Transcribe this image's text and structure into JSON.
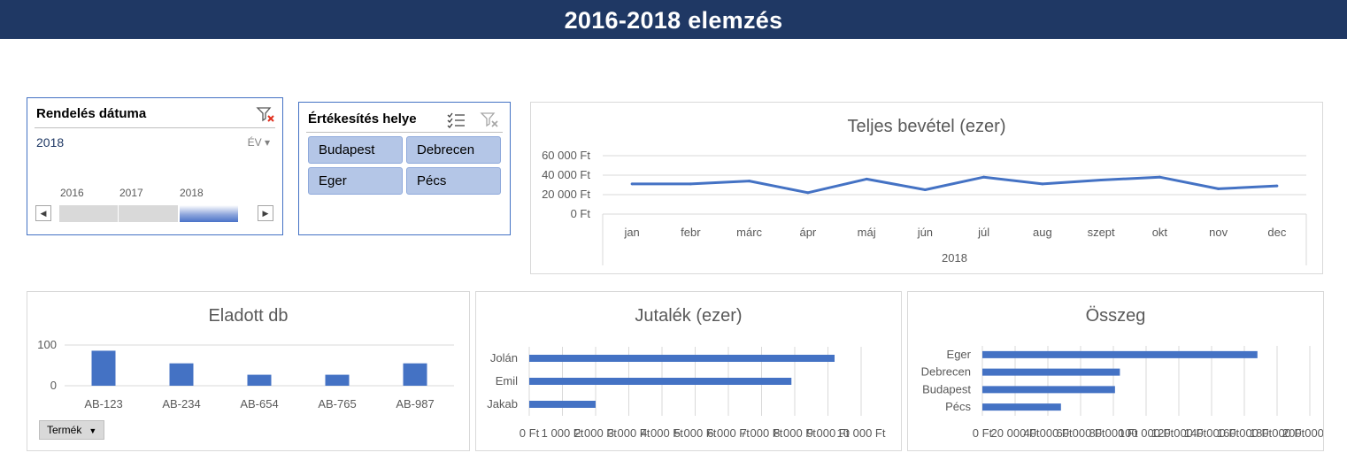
{
  "page_title": "2016-2018 elemzés",
  "timeline": {
    "title": "Rendelés dátuma",
    "selected": "2018",
    "level": "ÉV ▾",
    "years": [
      "2016",
      "2017",
      "2018"
    ],
    "selected_year": "2018"
  },
  "location_slicer": {
    "title": "Értékesítés helye",
    "items": [
      "Budapest",
      "Debrecen",
      "Eger",
      "Pécs"
    ]
  },
  "colors": {
    "accent": "#4472c4",
    "header": "#1f3864",
    "button": "#b4c6e7"
  },
  "chart_data": [
    {
      "type": "line",
      "title": "Teljes bevétel (ezer)",
      "categories": [
        "jan",
        "febr",
        "márc",
        "ápr",
        "máj",
        "jún",
        "júl",
        "aug",
        "szept",
        "okt",
        "nov",
        "dec"
      ],
      "group_label": "2018",
      "values": [
        31000,
        31000,
        34000,
        22000,
        36000,
        25000,
        38000,
        31000,
        35000,
        38000,
        26000,
        29000
      ],
      "ylim": [
        0,
        60000
      ],
      "yticks": [
        "0 Ft",
        "20 000 Ft",
        "40 000 Ft",
        "60 000 Ft"
      ],
      "grid": true
    },
    {
      "type": "bar",
      "title": "Eladott db",
      "categories": [
        "AB-123",
        "AB-234",
        "AB-654",
        "AB-765",
        "AB-987"
      ],
      "values": [
        86,
        55,
        27,
        27,
        55
      ],
      "ylim": [
        0,
        100
      ],
      "yticks": [
        "0",
        "100"
      ],
      "field_button": "Termék"
    },
    {
      "type": "bar",
      "orientation": "horizontal",
      "title": "Jutalék (ezer)",
      "categories": [
        "Jolán",
        "Emil",
        "Jakab"
      ],
      "values": [
        9200,
        7900,
        2000
      ],
      "xlim": [
        0,
        10000
      ],
      "xticks": [
        "0 Ft",
        "1 000 Ft",
        "2 000 Ft",
        "3 000 Ft",
        "4 000 Ft",
        "5 000 Ft",
        "6 000 Ft",
        "7 000 Ft",
        "8 000 Ft",
        "9 000 Ft",
        "10 000 Ft"
      ],
      "grid": true
    },
    {
      "type": "bar",
      "orientation": "horizontal",
      "title": "Összeg",
      "categories": [
        "Eger",
        "Debrecen",
        "Budapest",
        "Pécs"
      ],
      "values": [
        168000,
        84000,
        81000,
        48000
      ],
      "xlim": [
        0,
        200000
      ],
      "xticks": [
        "0 Ft",
        "20 000 Ft",
        "40 000 Ft",
        "60 000 Ft",
        "80 000 Ft",
        "100 000 Ft",
        "120 000 Ft",
        "140 000 Ft",
        "160 000 Ft",
        "180 000 Ft",
        "200 000 Ft"
      ],
      "grid": true
    }
  ]
}
